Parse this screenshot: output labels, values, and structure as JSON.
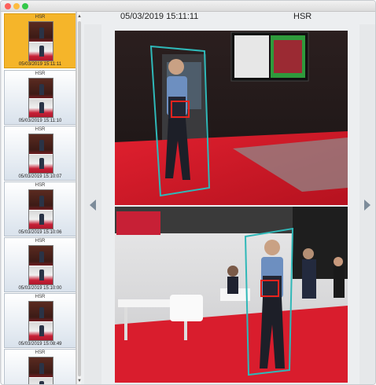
{
  "detection": {
    "timestamp": "05/03/2019 15:11:11",
    "type": "HSR"
  },
  "thumbnails": [
    {
      "label": "HSR",
      "time": "05/03/2019 15:11:11",
      "selected": true
    },
    {
      "label": "HSR",
      "time": "05/03/2019 15:11:10",
      "selected": false
    },
    {
      "label": "HSR",
      "time": "05/03/2019 15:10:07",
      "selected": false
    },
    {
      "label": "HSR",
      "time": "05/03/2019 15:10:06",
      "selected": false
    },
    {
      "label": "HSR",
      "time": "05/03/2019 15:10:00",
      "selected": false
    },
    {
      "label": "HSR",
      "time": "05/03/2019 15:08:49",
      "selected": false
    },
    {
      "label": "HSR",
      "time": "",
      "selected": false
    }
  ],
  "colors": {
    "selected_thumb": "#f5b52a",
    "detection_box": "#2fb8b8",
    "target_box": "#e8231d",
    "nav_arrow": "#7d8c9a"
  },
  "icons": {
    "prev": "chevron-left-icon",
    "next": "chevron-right-icon",
    "scroll_up": "scroll-up-arrow-icon",
    "scroll_down": "scroll-down-arrow-icon"
  }
}
